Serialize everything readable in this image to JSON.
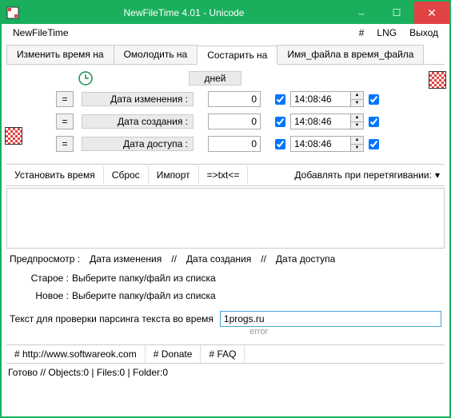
{
  "titlebar": {
    "title": "NewFileTime 4.01 - Unicode"
  },
  "menubar": {
    "app": "NewFileTime",
    "hash": "#",
    "lng": "LNG",
    "exit": "Выход"
  },
  "tabs": {
    "change": "Изменить время на",
    "younger": "Омолодить на",
    "older": "Состарить на",
    "filename": "Имя_файла в время_файла"
  },
  "panel": {
    "days_header": "дней",
    "rows": [
      {
        "label": "Дата изменения :",
        "days": "0",
        "time": "14:08:46"
      },
      {
        "label": "Дата создания :",
        "days": "0",
        "time": "14:08:46"
      },
      {
        "label": "Дата доступа :",
        "days": "0",
        "time": "14:08:46"
      }
    ]
  },
  "toolbar": {
    "set": "Установить время",
    "reset": "Сброс",
    "import": "Импорт",
    "txt": "=>txt<=",
    "drag": "Добавлять при перетягивании:"
  },
  "preview": {
    "label": "Предпросмотр :",
    "mod": "Дата изменения",
    "sep": "//",
    "crt": "Дата создания",
    "acc": "Дата доступа"
  },
  "info": {
    "old_label": "Старое :",
    "old_val": "Выберите папку/файл из списка",
    "new_label": "Новое :",
    "new_val": "Выберите папку/файл из списка"
  },
  "parse": {
    "label": "Текст для проверки парсинга текста во время",
    "value": "1progs.ru",
    "error": "error"
  },
  "links": {
    "site": "# http://www.softwareok.com",
    "donate": "# Donate",
    "faq": "# FAQ"
  },
  "status": "Готово // Objects:0 | Files:0 | Folder:0"
}
